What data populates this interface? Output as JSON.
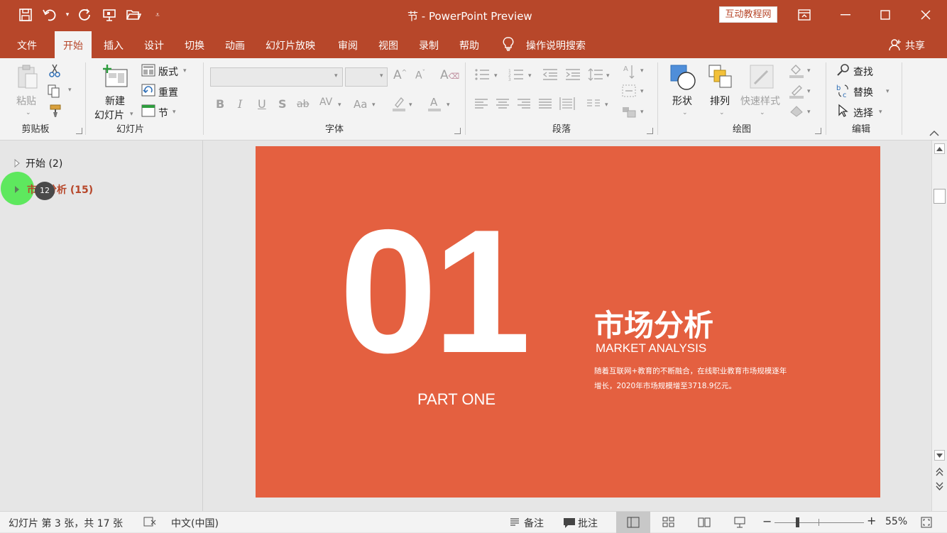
{
  "window": {
    "title": "节  -  PowerPoint Preview",
    "promo": "互动教程网"
  },
  "menu": {
    "tabs": [
      {
        "label": "文件"
      },
      {
        "label": "开始"
      },
      {
        "label": "插入"
      },
      {
        "label": "设计"
      },
      {
        "label": "切换"
      },
      {
        "label": "动画"
      },
      {
        "label": "幻灯片放映"
      },
      {
        "label": "审阅"
      },
      {
        "label": "视图"
      },
      {
        "label": "录制"
      },
      {
        "label": "帮助"
      }
    ],
    "tellme": "操作说明搜索",
    "share": "共享"
  },
  "ribbon": {
    "clipboard": {
      "paste": "粘贴",
      "group": "剪贴板"
    },
    "slides": {
      "new_slide_1": "新建",
      "new_slide_2": "幻灯片",
      "layout": "版式",
      "reset": "重置",
      "section": "节",
      "group": "幻灯片"
    },
    "font": {
      "group": "字体"
    },
    "paragraph": {
      "group": "段落"
    },
    "drawing": {
      "shapes": "形状",
      "arrange": "排列",
      "quick_styles": "快速样式",
      "group": "绘图"
    },
    "editing": {
      "find": "查找",
      "replace": "替换",
      "select": "选择",
      "group": "编辑"
    }
  },
  "sections": [
    {
      "label": "开始 (2)",
      "selected": false
    },
    {
      "label": "市场分析 (15)",
      "selected": true
    }
  ],
  "cursor_badge": "12",
  "slide": {
    "number": "01",
    "part": "PART ONE",
    "title": "市场分析",
    "subtitle": "MARKET ANALYSIS",
    "body_line1": "随着互联网+教育的不断融合，在线职业教育市场规模逐年",
    "body_line2": "增长，2020年市场规模增至3718.9亿元。",
    "bg_color": "#e46040"
  },
  "status": {
    "slide_info": "幻灯片 第 3 张，共 17 张",
    "language": "中文(中国)",
    "notes": "备注",
    "comments": "批注",
    "zoom": "55%"
  },
  "colors": {
    "accent": "#b7472a",
    "selected_section": "#b7472a"
  }
}
